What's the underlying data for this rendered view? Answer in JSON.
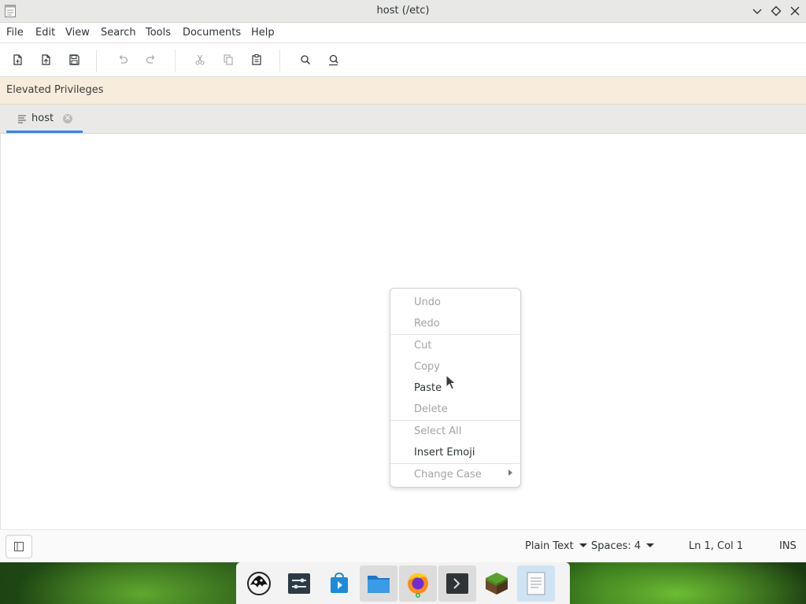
{
  "window": {
    "title": "host (/etc)"
  },
  "menubar": {
    "items": [
      "File",
      "Edit",
      "View",
      "Search",
      "Tools",
      "Documents",
      "Help"
    ]
  },
  "toolbar": {
    "buttons": [
      "new-document-icon",
      "open-document-icon",
      "save-icon",
      "undo-icon",
      "redo-icon",
      "cut-icon",
      "copy-icon",
      "paste-icon",
      "find-icon",
      "find-replace-icon"
    ]
  },
  "banner": {
    "text": "Elevated Privileges"
  },
  "tabs": [
    {
      "label": "host",
      "active": true
    }
  ],
  "context_menu": {
    "items": [
      {
        "label": "Undo",
        "enabled": false
      },
      {
        "label": "Redo",
        "enabled": false
      },
      {
        "label": "Cut",
        "enabled": false
      },
      {
        "label": "Copy",
        "enabled": false
      },
      {
        "label": "Paste",
        "enabled": true
      },
      {
        "label": "Delete",
        "enabled": false
      },
      {
        "label": "Select All",
        "enabled": false
      },
      {
        "label": "Insert Emoji",
        "enabled": true
      },
      {
        "label": "Change Case",
        "enabled": false,
        "submenu": true
      }
    ]
  },
  "statusbar": {
    "language": "Plain Text",
    "indent": "Spaces: 4",
    "position": "Ln 1, Col 1",
    "mode": "INS"
  },
  "dock": {
    "items": [
      "inkscape-icon",
      "settings-icon",
      "software-center-icon",
      "files-icon",
      "firefox-icon",
      "terminal-icon",
      "minecraft-icon",
      "text-editor-icon"
    ]
  },
  "colors": {
    "accent": "#3584e4",
    "banner_bg": "#f8ecdc"
  }
}
